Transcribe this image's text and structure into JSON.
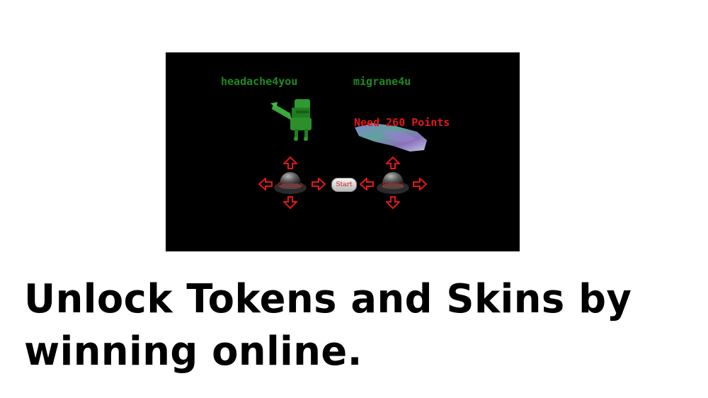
{
  "game": {
    "player1_name": "headache4you",
    "player2_name": "migrane4u",
    "locked_message": "Need 260 Points",
    "buttons": {
      "change": "Change",
      "start": "Start",
      "rotate": "Rotate"
    }
  },
  "caption": {
    "text": "Unlock Tokens and Skins by winning online."
  },
  "colors": {
    "name_green": "#1f8a1f",
    "alert_red": "#e01818",
    "background": "#000000"
  }
}
